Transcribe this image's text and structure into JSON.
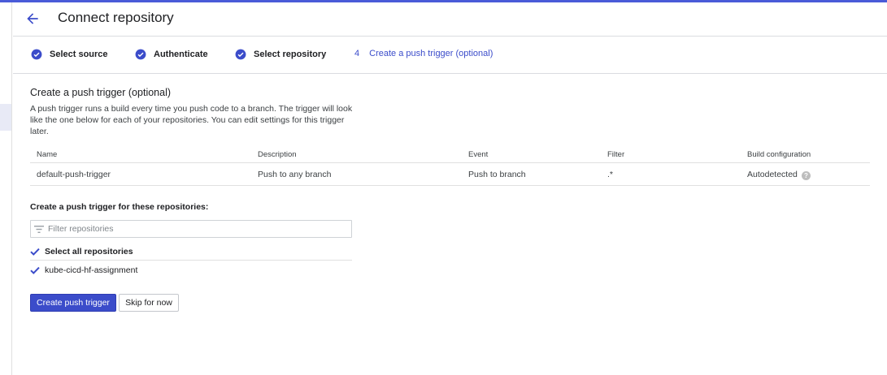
{
  "colors": {
    "accent": "#3b4cca",
    "top_border": "#4a5bd8",
    "check": "#3b4cca"
  },
  "header": {
    "title": "Connect repository",
    "back_icon": "arrow-left-icon"
  },
  "stepper": {
    "steps": [
      {
        "label": "Select source",
        "status": "done",
        "icon": "check-circle-icon"
      },
      {
        "label": "Authenticate",
        "status": "done",
        "icon": "check-circle-icon"
      },
      {
        "label": "Select repository",
        "status": "done",
        "icon": "check-circle-icon"
      },
      {
        "number": "4",
        "label": "Create a push trigger (optional)",
        "status": "active"
      }
    ]
  },
  "section": {
    "title": "Create a push trigger (optional)",
    "description": "A push trigger runs a build every time you push code to a branch. The trigger will look like the one below for each of your repositories. You can edit settings for this trigger later."
  },
  "table": {
    "headers": [
      "Name",
      "Description",
      "Event",
      "Filter",
      "Build configuration"
    ],
    "rows": [
      [
        "default-push-trigger",
        "Push to any branch",
        "Push to branch",
        ".*",
        "Autodetected"
      ]
    ],
    "help_icon": "help-circle-icon"
  },
  "repositories": {
    "label": "Create a push trigger for these repositories:",
    "filter_placeholder": "Filter repositories",
    "filter_value": "",
    "filter_icon": "filter-list-icon",
    "select_all": {
      "label": "Select all repositories",
      "checked": true
    },
    "items": [
      {
        "label": "kube-cicd-hf-assignment",
        "checked": true
      }
    ]
  },
  "actions": {
    "create_label": "Create push trigger",
    "skip_label": "Skip for now"
  }
}
